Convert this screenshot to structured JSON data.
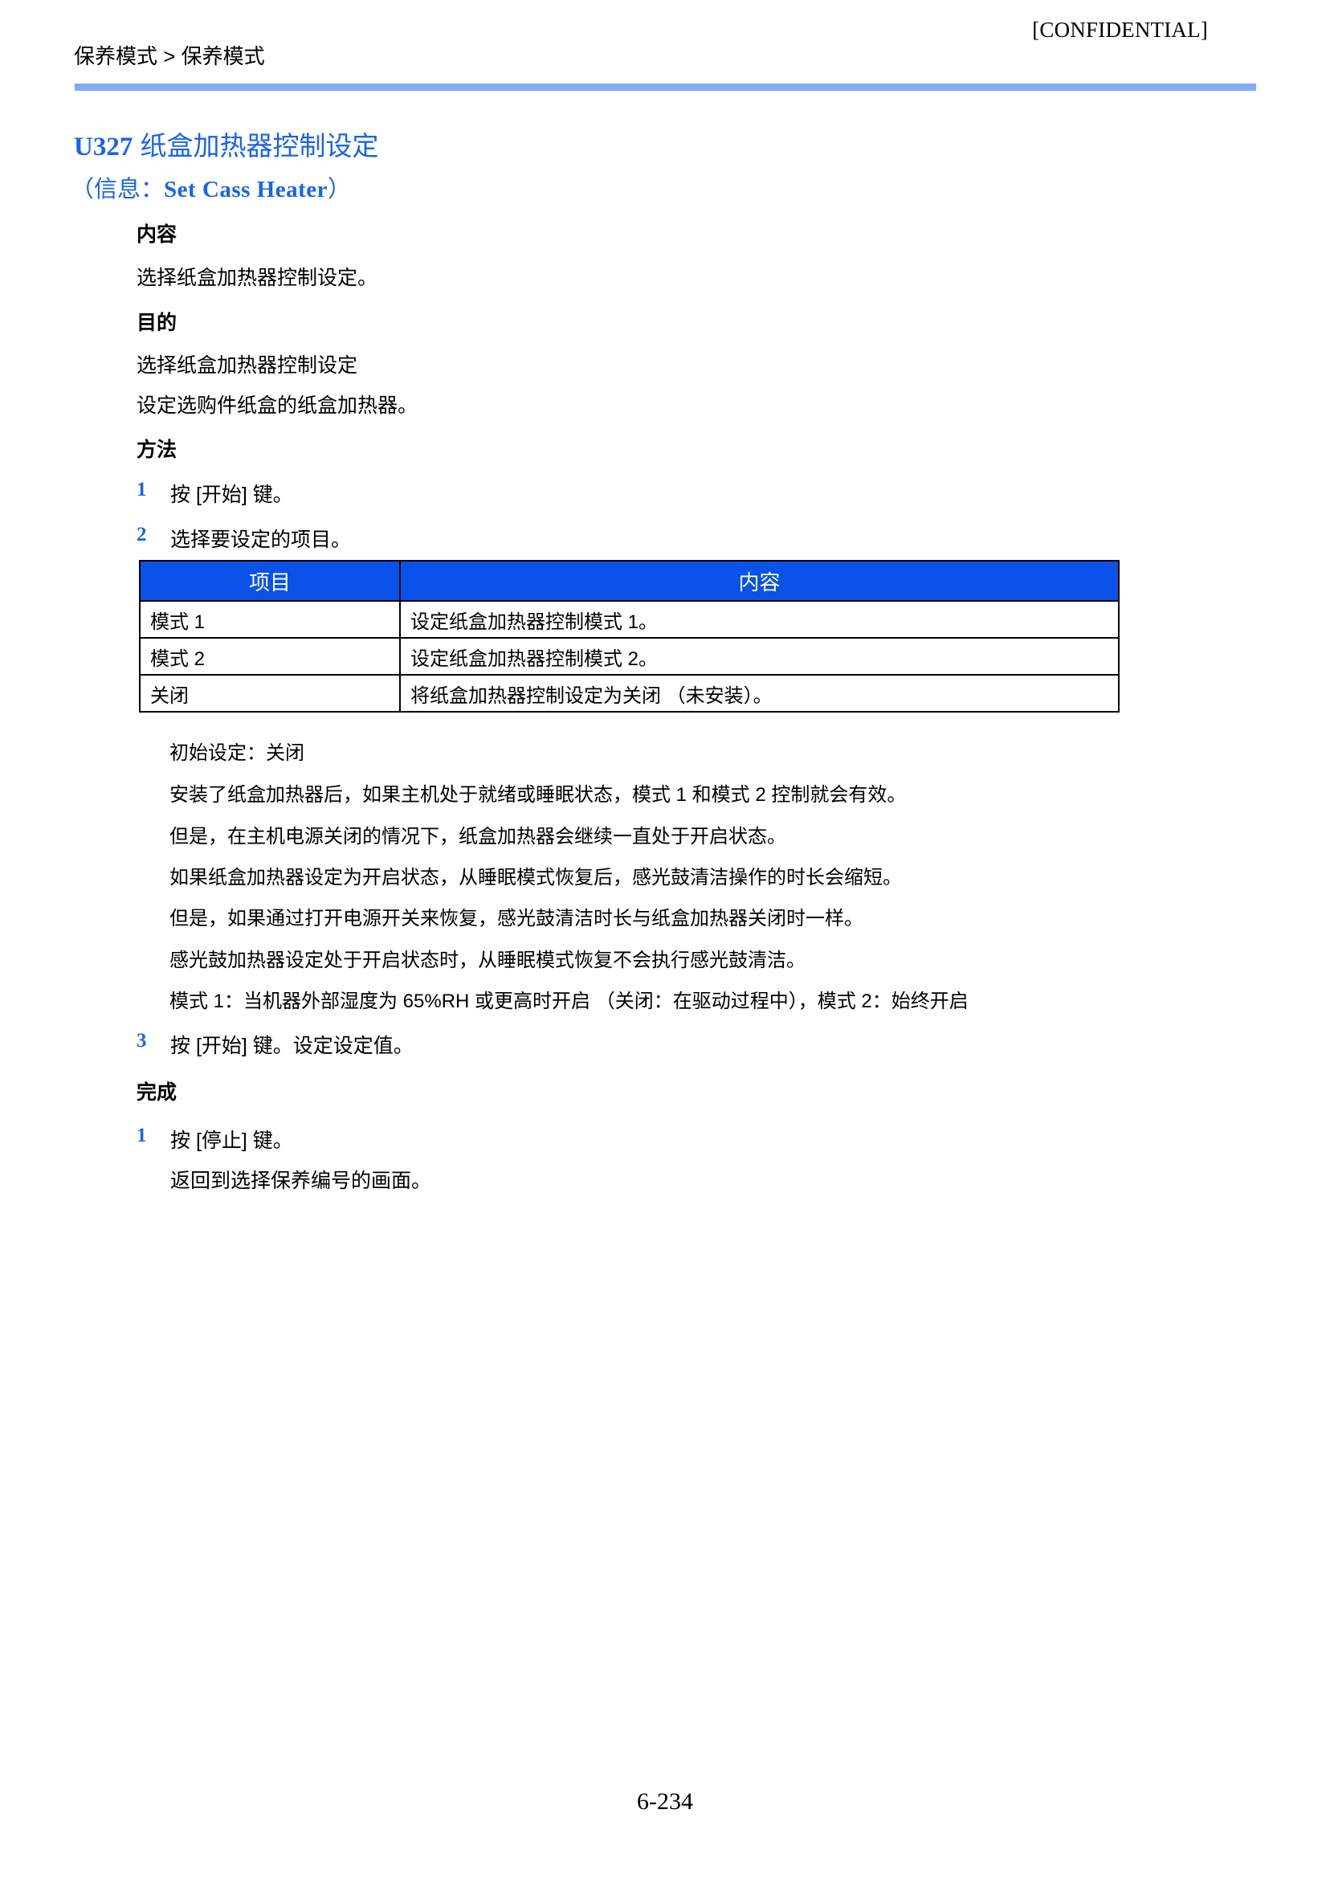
{
  "header": {
    "confidential": "[CONFIDENTIAL]",
    "breadcrumb": "保养模式 > 保养模式",
    "rule_color": "#82aaf5"
  },
  "title": {
    "code": "U327",
    "name": "纸盒加热器控制设定",
    "subtitle_prefix": "（信息：",
    "subtitle_en": "Set Cass Heater",
    "subtitle_suffix": "）",
    "color": "#1a63ea"
  },
  "sections": {
    "description_heading": "内容",
    "description_text": "选择纸盒加热器控制设定。",
    "purpose_heading": "目的",
    "purpose_line1": "选择纸盒加热器控制设定",
    "purpose_line2": "设定选购件纸盒的纸盒加热器。",
    "method_heading": "方法",
    "completion_heading": "完成"
  },
  "steps": [
    {
      "num": "1",
      "text": "按 [开始] 键。"
    },
    {
      "num": "2",
      "text": "选择要设定的项目。"
    },
    {
      "num": "3",
      "text": "按 [开始] 键。设定设定值。"
    }
  ],
  "completion_steps": [
    {
      "num": "1",
      "text": "按 [停止] 键。"
    }
  ],
  "completion_note": "返回到选择保养编号的画面。",
  "table": {
    "header_bg": "#0a52e8",
    "columns": [
      "项目",
      "内容"
    ],
    "rows": [
      {
        "item": "模式 1",
        "content": "设定纸盒加热器控制模式 1。"
      },
      {
        "item": "模式 2",
        "content": "设定纸盒加热器控制模式 2。"
      },
      {
        "item": "关闭",
        "content": "将纸盒加热器控制设定为关闭 （未安装）。"
      }
    ]
  },
  "notes": [
    "初始设定：关闭",
    "安装了纸盒加热器后，如果主机处于就绪或睡眠状态，模式 1 和模式 2 控制就会有效。",
    "但是，在主机电源关闭的情况下，纸盒加热器会继续一直处于开启状态。",
    "如果纸盒加热器设定为开启状态，从睡眠模式恢复后，感光鼓清洁操作的时长会缩短。",
    "但是，如果通过打开电源开关来恢复，感光鼓清洁时长与纸盒加热器关闭时一样。",
    "感光鼓加热器设定处于开启状态时，从睡眠模式恢复不会执行感光鼓清洁。",
    "模式 1：当机器外部湿度为 65%RH 或更高时开启 （关闭：在驱动过程中），模式 2：始终开启"
  ],
  "footer": {
    "page_number": "6-234"
  }
}
